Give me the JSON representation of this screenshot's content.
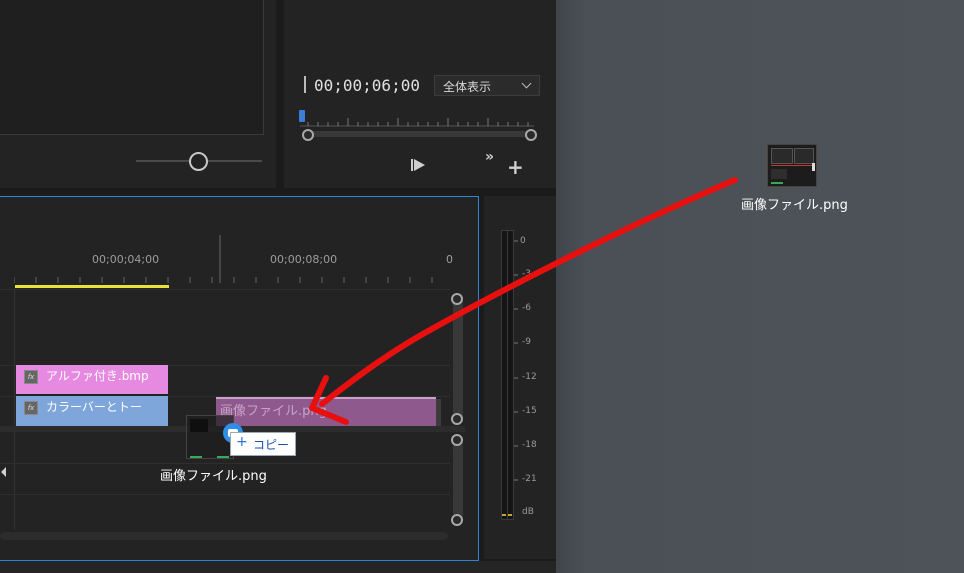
{
  "program_monitor": {
    "timecode": "00;00;06;00",
    "zoom_select": "全体表示"
  },
  "timeline": {
    "ruler_labels": [
      "00;00;04;00",
      "00;00;08;00",
      "0"
    ],
    "clips": [
      {
        "label": "アルファ付き.bmp",
        "fx": "fx"
      },
      {
        "label": "カラーバーとトー",
        "fx": "fx"
      },
      {
        "label": "画像ファイル.png"
      }
    ]
  },
  "audio_meter": {
    "scale": [
      "0",
      "-3",
      "-6",
      "-9",
      "-12",
      "-15",
      "-18",
      "-21",
      "dB"
    ]
  },
  "drag": {
    "tooltip": "コピー",
    "tooltip_icon": "+",
    "filename": "画像ファイル.png"
  },
  "desktop": {
    "file_label": "画像ファイル.png"
  },
  "colors": {
    "annotation_arrow": "#e8100f",
    "clip_pink": "#e58ae0",
    "clip_blue": "#7ea6db",
    "clip_purple": "#8e5a8e",
    "playhead": "#3a7ed8",
    "work_area": "#e9e23a",
    "panel_focus": "#2f84d6"
  }
}
